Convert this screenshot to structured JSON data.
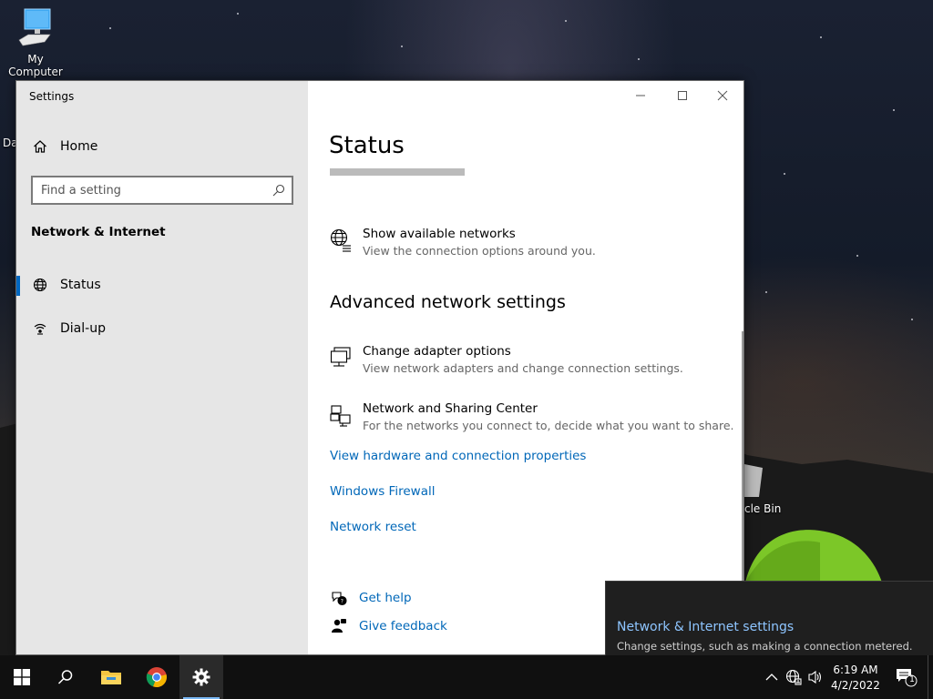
{
  "desktop": {
    "icons": [
      {
        "label": "My Computer"
      },
      {
        "label": "Da"
      },
      {
        "label": "cle Bin"
      }
    ]
  },
  "settings": {
    "window_title": "Settings",
    "sidebar": {
      "home_label": "Home",
      "search_placeholder": "Find a setting",
      "section_heading": "Network & Internet",
      "items": [
        {
          "label": "Status",
          "icon": "globe-icon",
          "selected": true
        },
        {
          "label": "Dial-up",
          "icon": "dialup-icon",
          "selected": false
        }
      ]
    },
    "main": {
      "title": "Status",
      "items_top": [
        {
          "title": "Show available networks",
          "desc": "View the connection options around you.",
          "icon": "network-list-icon"
        }
      ],
      "advanced_heading": "Advanced network settings",
      "advanced_items": [
        {
          "title": "Change adapter options",
          "desc": "View network adapters and change connection settings.",
          "icon": "adapter-icon"
        },
        {
          "title": "Network and Sharing Center",
          "desc": "For the networks you connect to, decide what you want to share.",
          "icon": "sharing-center-icon"
        }
      ],
      "links": [
        "View hardware and connection properties",
        "Windows Firewall",
        "Network reset"
      ],
      "help": {
        "get_help": "Get help",
        "give_feedback": "Give feedback"
      }
    }
  },
  "toast": {
    "title": "Network & Internet settings",
    "desc": "Change settings, such as making a connection metered."
  },
  "taskbar": {
    "time": "6:19 AM",
    "date": "4/2/2022",
    "notification_count": "1"
  },
  "colors": {
    "accent": "#0067c0",
    "link": "#0067b8",
    "sidebar_bg": "#e6e6e6",
    "taskbar_bg": "#101010"
  }
}
